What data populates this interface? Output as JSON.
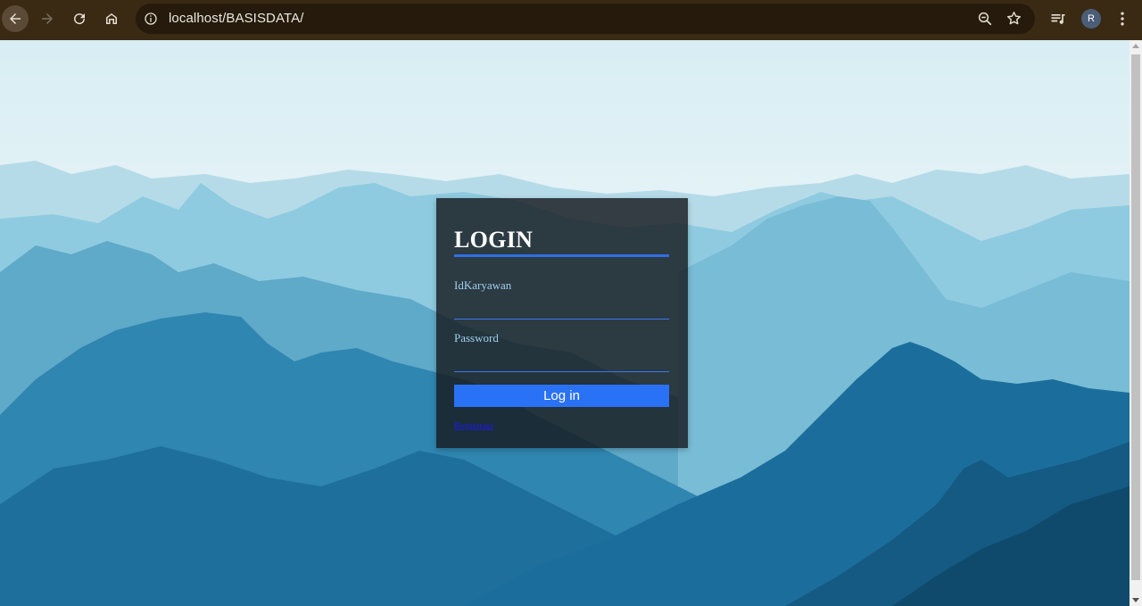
{
  "browser": {
    "url": "localhost/BASISDATA/",
    "profile_initial": "R",
    "icons": {
      "back": "arrow-left",
      "forward": "arrow-right",
      "reload": "reload",
      "home": "home",
      "site_info": "info-circle",
      "zoom": "magnifier-minus",
      "bookmark": "star",
      "media": "media-queue",
      "menu": "vertical-dots"
    }
  },
  "login": {
    "title": "LOGIN",
    "id_label": "IdKaryawan",
    "id_value": "",
    "password_label": "Password",
    "password_value": "",
    "submit_label": "Log in",
    "register_label": "Registrasi"
  },
  "colors": {
    "chrome": "#3a2a14",
    "accent": "#2f6fe4",
    "button": "#2a72f5",
    "panel": "rgba(22,26,30,0.82)",
    "label": "#9fd0f0"
  }
}
